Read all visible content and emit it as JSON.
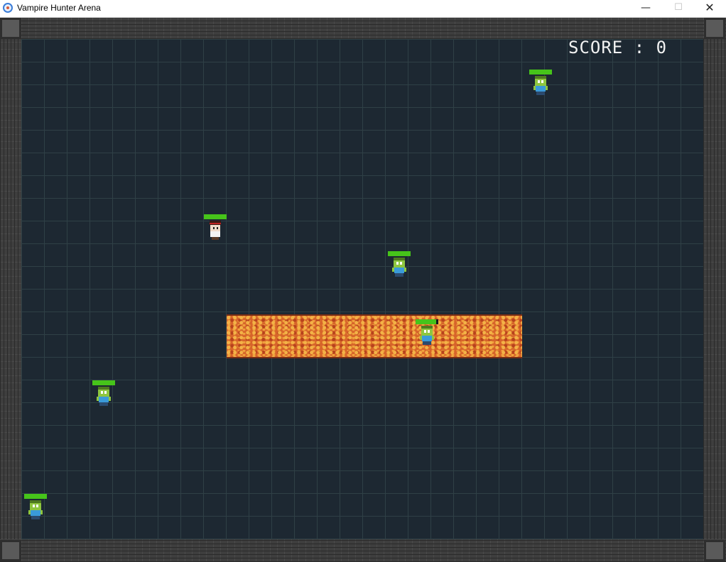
{
  "window": {
    "title": "Vampire Hunter Arena",
    "minimize_glyph": "—",
    "maximize_glyph": "☐",
    "close_glyph": "✕"
  },
  "hud": {
    "score_label": "SCORE : 0"
  },
  "sprites": [
    {
      "kind": "zombie",
      "health": 1.0
    },
    {
      "kind": "hunter",
      "health": 1.0
    },
    {
      "kind": "zombie",
      "health": 1.0
    },
    {
      "kind": "zombie",
      "health": 0.9
    },
    {
      "kind": "zombie",
      "health": 1.0
    },
    {
      "kind": "zombie",
      "health": 1.0
    }
  ],
  "colors": {
    "floor": "#1d2832",
    "grid_line": "#2f4046",
    "lava": "#d7642a",
    "health_bar": "#46c41a",
    "score_text": "#f2f2f2"
  }
}
